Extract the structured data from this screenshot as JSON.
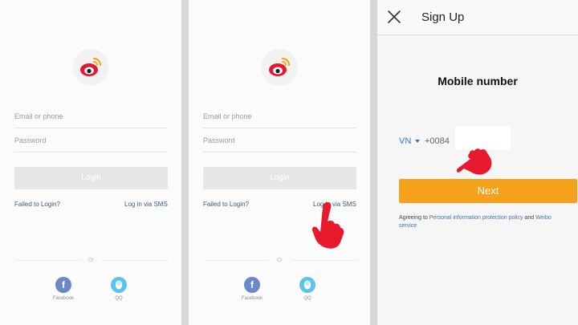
{
  "login": {
    "email_placeholder": "Email or phone",
    "password_placeholder": "Password",
    "login_label": "Login",
    "failed_label": "Failed to Login?",
    "sms_label": "Log in via SMS",
    "or_label": "Or",
    "facebook_label": "Facebook",
    "qq_label": "QQ",
    "facebook_glyph": "f"
  },
  "signup": {
    "title": "Sign Up",
    "heading": "Mobile number",
    "country": "VN",
    "dial_code": "+0084",
    "phone_value": "",
    "next_label": "Next",
    "agree_prefix": "Agreeing to ",
    "privacy_link": "Personal information protection policy",
    "agree_and": " and ",
    "service_link": "Weibo service"
  },
  "icons": {
    "logo": "weibo-logo-icon",
    "facebook": "facebook-icon",
    "qq": "qq-penguin-icon",
    "hand": "pointing-hand-icon",
    "close": "close-icon",
    "caret": "caret-down-icon"
  },
  "colors": {
    "accent_orange": "#f5a11b",
    "link_blue": "#3f73b0",
    "weibo_red": "#e6162d",
    "facebook_blue": "#6a87c7",
    "qq_blue": "#59c4ef"
  }
}
